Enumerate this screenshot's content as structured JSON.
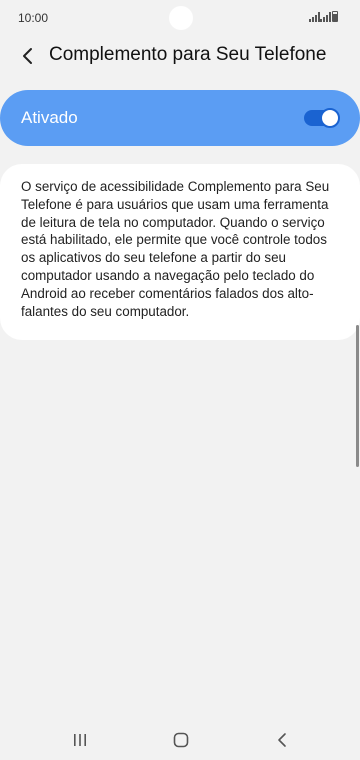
{
  "status_bar": {
    "time": "10:00"
  },
  "header": {
    "title": "Complemento para Seu Telefone",
    "back_icon": "chevron-left-icon"
  },
  "toggle": {
    "label": "Ativado",
    "state": "on",
    "card_color": "#5b9df3",
    "switch_color": "#1a63d1"
  },
  "description": {
    "text": "O serviço de acessibilidade Complemento para Seu Telefone é para usuários que usam uma ferramenta de leitura de tela no computador. Quando o serviço está habilitado, ele permite que você controle todos os aplicativos do seu telefone a partir do seu computador usando a navegação pelo teclado do Android ao receber comentários falados dos alto-falantes do seu computador."
  },
  "nav_bar": {
    "recents_icon": "recents-icon",
    "home_icon": "home-icon",
    "back_icon": "back-icon"
  }
}
